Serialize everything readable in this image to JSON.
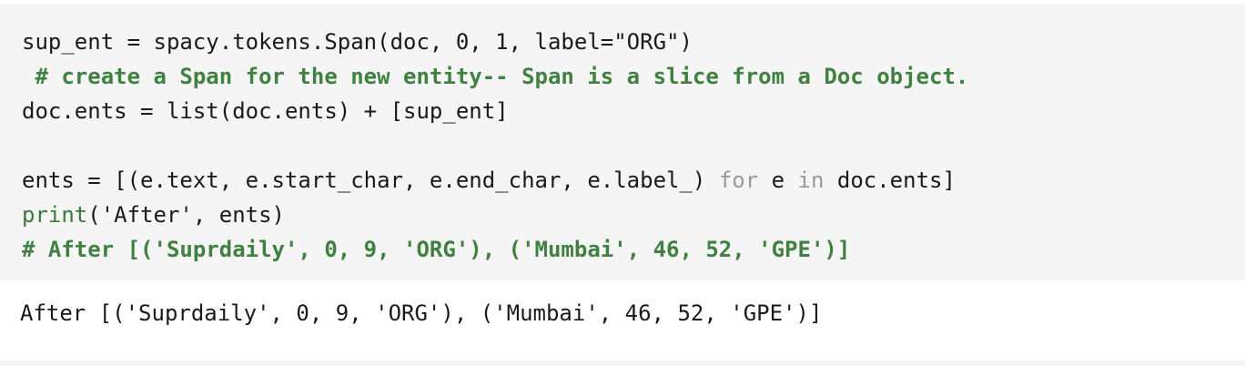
{
  "code": {
    "line1": "sup_ent = spacy.tokens.Span(doc, 0, 1, label=\"ORG\")",
    "line2": " # create a Span for the new entity-- Span is a slice from a Doc object.",
    "line3": "doc.ents = list(doc.ents) + [sup_ent]",
    "line4_pre": "ents = [(e.text, e.start_char, e.end_char, e.label_) ",
    "line4_for": "for",
    "line4_mid": " e ",
    "line4_in": "in",
    "line4_post": " doc.ents]",
    "line5_print": "print",
    "line5_args": "('After', ents)",
    "line6": "# After [('Suprdaily', 0, 9, 'ORG'), ('Mumbai', 46, 52, 'GPE')]"
  },
  "output": {
    "text": "After [('Suprdaily', 0, 9, 'ORG'), ('Mumbai', 46, 52, 'GPE')]"
  },
  "colors": {
    "code_background": "#f5f5f5",
    "comment": "#408040",
    "keyword": "#9a9a9a"
  }
}
